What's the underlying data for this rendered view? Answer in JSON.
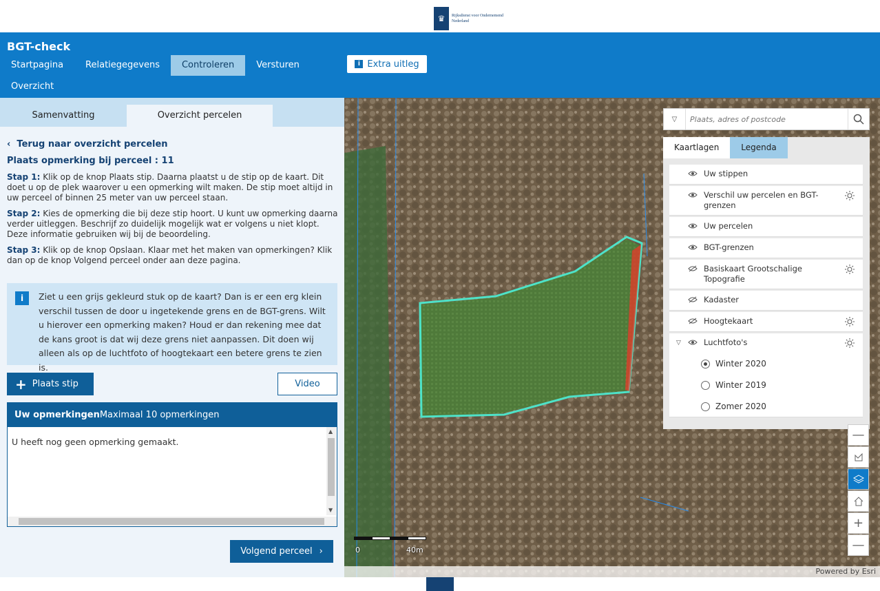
{
  "logo": {
    "line1": "Rijksdienst voor Ondernemend",
    "line2": "Nederland"
  },
  "header": {
    "title": "BGT-check",
    "nav": [
      "Startpagina",
      "Relatiegegevens",
      "Controleren",
      "Versturen"
    ],
    "nav2": "Overzicht",
    "extra": "Extra uitleg"
  },
  "left": {
    "tabs": [
      "Samenvatting",
      "Overzicht percelen"
    ],
    "back": "Terug naar overzicht percelen",
    "subtitle": "Plaats opmerking bij perceel : 11",
    "step1_label": "Stap 1:",
    "step1_text": " Klik op de knop Plaats stip. Daarna plaatst u de stip op de kaart. Dit doet u op de plek waarover u een opmerking wilt maken. De stip moet altijd in uw perceel of binnen 25 meter van uw perceel staan.",
    "step2_label": "Stap 2:",
    "step2_text": " Kies de opmerking die bij deze stip hoort. U kunt uw opmerking daarna verder uitleggen. Beschrijf zo duidelijk mogelijk wat er volgens u niet klopt. Deze informatie gebruiken wij bij de beoordeling.",
    "step3_label": "Stap 3:",
    "step3_text": " Klik op de knop Opslaan. Klaar met het maken van opmerkingen? Klik dan op de knop Volgend perceel onder aan deze pagina.",
    "info": "Ziet u een grijs gekleurd stuk op de kaart? Dan is er een erg klein verschil tussen de door u ingetekende grens en de BGT-grens. Wilt u hierover een opmerking maken? Houd er dan rekening mee dat de kans groot is dat wij deze grens niet aanpassen. Dit doen wij alleen als op de luchtfoto of hoogtekaart een betere grens te zien is.",
    "plaats": "Plaats stip",
    "video": "Video",
    "opm_title": "Uw opmerkingen",
    "opm_sub": "Maximaal 10 opmerkingen",
    "opm_msg": "U heeft nog geen opmerking gemaakt.",
    "volgend": "Volgend perceel"
  },
  "map": {
    "search_placeholder": "Plaats, adres of postcode",
    "panel_tabs": [
      "Kaartlagen",
      "Legenda"
    ],
    "layers": [
      {
        "name": "Uw stippen",
        "settings": false
      },
      {
        "name": "Verschil uw percelen en BGT-grenzen",
        "settings": true
      },
      {
        "name": "Uw percelen",
        "settings": false
      },
      {
        "name": "BGT-grenzen",
        "settings": false
      },
      {
        "name": "Basiskaart Grootschalige Topografie",
        "settings": true
      },
      {
        "name": "Kadaster",
        "settings": false
      },
      {
        "name": "Hoogtekaart",
        "settings": true
      },
      {
        "name": "Luchtfoto's",
        "settings": true
      }
    ],
    "luchtfoto_options": [
      "Winter 2020",
      "Winter 2019",
      "Zomer 2020"
    ],
    "selected_option": "Winter 2020",
    "scale_start": "0",
    "scale_end": "40m",
    "attribution": "Powered by Esri",
    "colors": {
      "parcel": "#4de3c8",
      "difference": "#e83a2a",
      "bgt": "#1e90ff"
    }
  }
}
